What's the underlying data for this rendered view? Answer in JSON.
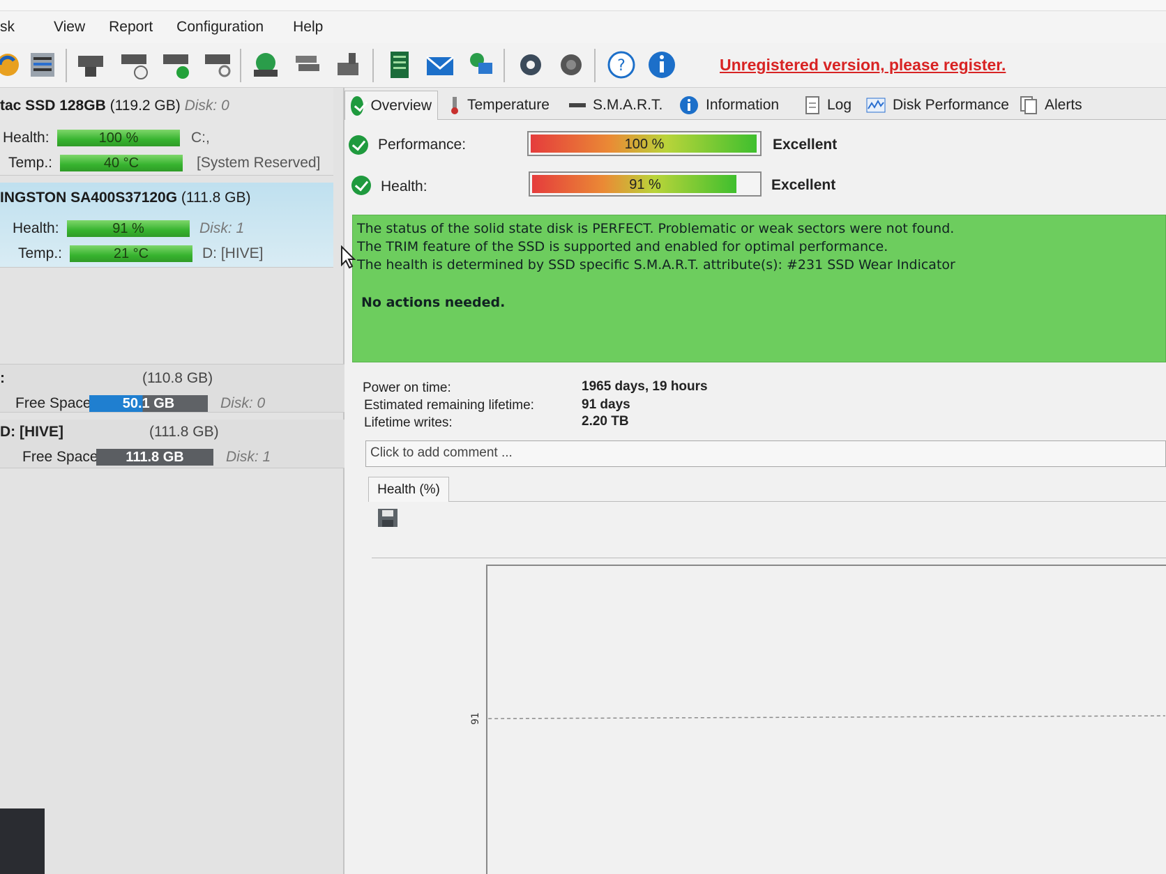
{
  "menu": [
    "sk",
    "View",
    "Report",
    "Configuration",
    "Help"
  ],
  "register_text": "Unregistered version, please register.",
  "toolbar_icons": [
    "refresh-icon",
    "disk-list-icon",
    "disk-icon",
    "disk-clock-icon",
    "disk-check-icon",
    "disk-search-icon",
    "globe-disk-icon",
    "disk-stack-icon",
    "disk-export-icon",
    "notepad-icon",
    "email-icon",
    "network-icon",
    "settings-gear-icon",
    "sound-icon",
    "help-icon",
    "info-icon"
  ],
  "disks": [
    {
      "name_prefix": "tac SSD 128GB",
      "size": "(119.2 GB)",
      "disk_label": "Disk: 0",
      "health_label": "Health:",
      "health_value": "100 %",
      "health_fraction": 1.0,
      "health_extra": "C:,",
      "temp_label": "Temp.:",
      "temp_value": "40 °C",
      "temp_extra": "[System Reserved]"
    },
    {
      "name_prefix": "INGSTON SA400S37120G",
      "size": "(111.8 GB)",
      "health_label": "Health:",
      "health_value": "91 %",
      "health_fraction": 0.91,
      "health_extra": "Disk: 1",
      "temp_label": "Temp.:",
      "temp_value": "21 °C",
      "temp_extra": "D: [HIVE]"
    }
  ],
  "volumes": [
    {
      "name": ":",
      "size": "(110.8 GB)",
      "free_label": "Free Space",
      "free_value": "50.1 GB",
      "free_fraction": 0.45,
      "disk_label": "Disk: 0"
    },
    {
      "name": "D: [HIVE]",
      "size": "(111.8 GB)",
      "free_label": "Free Space",
      "free_value": "111.8 GB",
      "free_fraction": 1.0,
      "disk_label": "Disk: 1"
    }
  ],
  "tabs": [
    "Overview",
    "Temperature",
    "S.M.A.R.T.",
    "Information",
    "Log",
    "Disk Performance",
    "Alerts"
  ],
  "performance": {
    "label": "Performance:",
    "value": "100 %",
    "fraction": 1.0,
    "rating": "Excellent"
  },
  "health": {
    "label": "Health:",
    "value": "91 %",
    "fraction": 0.91,
    "rating": "Excellent"
  },
  "status_lines": [
    "The status of the solid state disk is PERFECT. Problematic or weak sectors were not found.",
    "The TRIM feature of the SSD is supported and enabled for optimal performance.",
    "The health is determined by SSD specific S.M.A.R.T. attribute(s):  #231 SSD Wear Indicator"
  ],
  "status_action": "No actions needed.",
  "info": [
    {
      "label": "Power on time:",
      "value": "1965 days, 19 hours"
    },
    {
      "label": "Estimated remaining lifetime:",
      "value": "91 days"
    },
    {
      "label": "Lifetime writes:",
      "value": "2.20 TB"
    }
  ],
  "comment_placeholder": "Click to add comment ...",
  "chart_tab": "Health (%)",
  "chart_data": {
    "type": "line",
    "title": "",
    "xlabel": "",
    "ylabel": "",
    "y_ticks": [
      "91"
    ],
    "series": [
      {
        "values": [
          91
        ]
      }
    ]
  },
  "colors": {
    "accent_green": "#37b32f",
    "status_green": "#6dcd5e",
    "register_red": "#d82323",
    "free_blue": "#1f7fd0"
  }
}
